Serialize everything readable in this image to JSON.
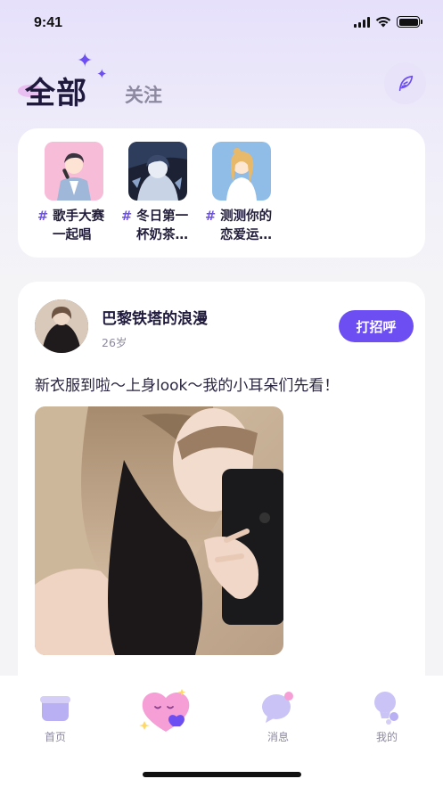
{
  "status_bar": {
    "time": "9:41"
  },
  "tabs": {
    "active": "全部",
    "other": "关注"
  },
  "topics": [
    {
      "line1": "歌手大赛",
      "line2": "一起唱"
    },
    {
      "line1": "冬日第一",
      "line2": "杯奶茶…"
    },
    {
      "line1": "测测你的",
      "line2": "恋爱运…"
    }
  ],
  "topic_hash": "#",
  "post": {
    "user_name": "巴黎铁塔的浪漫",
    "age": "26岁",
    "greet_label": "打招呼",
    "text": "新衣服到啦～上身look～我的小耳朵们先看！"
  },
  "nav": [
    {
      "label": "首页"
    },
    {
      "label": ""
    },
    {
      "label": "消息"
    },
    {
      "label": "我的"
    }
  ],
  "colors": {
    "accent": "#6c4ef2",
    "pink": "#f59fd6"
  }
}
